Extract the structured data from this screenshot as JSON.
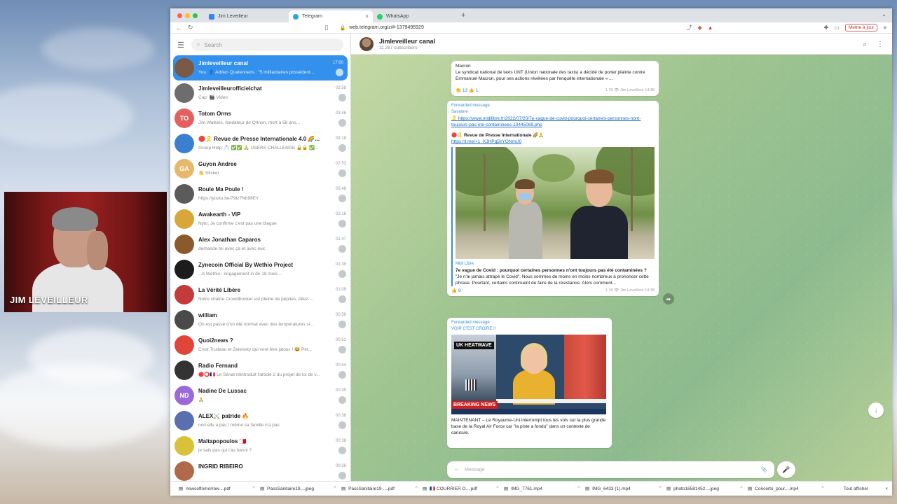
{
  "webcam": {
    "name": "JIM LEVEILLEUR"
  },
  "browser": {
    "tabs": [
      {
        "label": "Jim Leveilleur",
        "color": "#3b82f6"
      },
      {
        "label": "Telegram",
        "color": "#2aa3e0",
        "active": true
      },
      {
        "label": "WhatsApp",
        "color": "#25d366"
      }
    ],
    "new_tab": "+",
    "close": "×",
    "url": "web.telegram.org/z/#-1379495929",
    "update_button": "Mettre à jour"
  },
  "telegram": {
    "search_placeholder": "Search",
    "chats": [
      {
        "name": "Jimleveilleur canal",
        "time": "17:00",
        "preview": "You: 👤 Adrien Quatennens : \"5 milliardaires possèdent...",
        "initials": "",
        "color": "#7a5a44",
        "active": true
      },
      {
        "name": "Jimleveilleurofficielchat",
        "time": "02:58",
        "preview": "Cap: 🎬 Video",
        "initials": "",
        "color": "#6d6d6d"
      },
      {
        "name": "Totom Orms",
        "time": "03:46",
        "preview": "Jim Watkins, fondateur de Q4non, mort à 58 ans...",
        "initials": "TO",
        "color": "#e45f5f"
      },
      {
        "name": "🔴🎗️ Revue de Presse Internationale 4.0 🌈...",
        "time": "03:18",
        "preview": "Group Help: 📩 ✅✅ 🙏 USERS CHALLENGE 🔒🔒 ✅...",
        "initials": "",
        "color": "#3b7fd1"
      },
      {
        "name": "Guyon Andree",
        "time": "02:53",
        "preview": "👋 Sticker",
        "initials": "GA",
        "color": "#e8b86a"
      },
      {
        "name": "Roule Ma Poule !",
        "time": "02:48",
        "preview": "https://youtu.be/79Iz7Nb98EY",
        "initials": "",
        "color": "#5b5b5b"
      },
      {
        "name": "Awakearth - VIP",
        "time": "02:16",
        "preview": "Nyto: Je confirme c'est pas une blague",
        "initials": "",
        "color": "#d9a63a"
      },
      {
        "name": "Alex Jonathan Caparos",
        "time": "01:47",
        "preview": "demande toi avec ça et avec eux",
        "initials": "",
        "color": "#8a5a2a"
      },
      {
        "name": "Zynecoin Official By Wethio Project",
        "time": "01:39",
        "preview": "...b Wethio : engagement in de 18 mois...",
        "initials": "",
        "color": "#1c1c1c"
      },
      {
        "name": "La Vérité Libère",
        "time": "01:09",
        "preview": "Notre chaîne Crowdbunker est pleine de pépites. Allez-...",
        "initials": "",
        "color": "#c43b3b"
      },
      {
        "name": "william",
        "time": "00:59",
        "preview": "On est passé d'un été normal avec des températures si...",
        "initials": "",
        "color": "#4a4a4a"
      },
      {
        "name": "Quoi2news ?",
        "time": "00:52",
        "preview": "C'est Trudeau et Zelensky qui vont être jaloux ! 😂 Pet...",
        "initials": "",
        "color": "#e0453a"
      },
      {
        "name": "Radio Fernand",
        "time": "00:44",
        "preview": "🔴⭕🇫🇷 Le Sénat réintroduit l'article 2 du projet de loi de v...",
        "initials": "",
        "color": "#333333"
      },
      {
        "name": "Nadine De Lussac",
        "time": "00:39",
        "preview": "🙏",
        "initials": "ND",
        "color": "#9b6ad8"
      },
      {
        "name": "ALEX⚔️ patride 🔥",
        "time": "00:38",
        "preview": "non elle a pas ! même sa famille n'a pas",
        "initials": "",
        "color": "#5a6fb0"
      },
      {
        "name": "Maltapopoulos 🇲🇹",
        "time": "00:38",
        "preview": "je sais pas qui t'as banni ?",
        "initials": "",
        "color": "#d8c23a"
      },
      {
        "name": "INGRID RIBEIRO",
        "time": "00:36",
        "preview": "",
        "initials": "",
        "color": "#b06a4a"
      }
    ],
    "channel": {
      "title": "Jimleveilleur canal",
      "subtitle": "11 267 subscribers"
    },
    "messages": {
      "m1": {
        "head": "Macron",
        "text": "Le syndicat national de taxis UNT (Union nationale des taxis) a décidé de porter plainte contre Emmanuel Macron, pour ses actions révélées par l'enquête internationale « ...",
        "reactions": "👏 13   👍 1",
        "stamp": "1.7K 👁 Jim Leveilleur 14:38"
      },
      "m2": {
        "forwarded": "Forwarded message",
        "source": "Savanne",
        "link": "🎗️ https://www.midilibre.fr/2022/07/20/7e-vague-de-covid-pourquoi-certaines-personnes-nont-toujours-pas-ete-contaminees-10445069.php",
        "title": "🔴🎗️ Revue de Presse Internationale 🌈🙏",
        "title_link": "https://t.me/+1_KJHPg5lrYONmU0",
        "site": "Midi Libre",
        "preview_title": "7e vague de Covid : pourquoi certaines personnes n'ont toujours pas été contaminées ?",
        "preview_text": "\"Je n'ai jamais attrapé le Covid\". Nous sommes de moins en moins nombreux à prononcer cette phrase. Pourtant, certains continuent de faire de la résistance. Alors comment...",
        "reactions": "👍 9",
        "stamp": "1.7K 👁 Jim Leveilleur 14:38"
      },
      "m3": {
        "forwarded": "Forwarded message",
        "source": "VOIR C'EST CROIRE !!",
        "tv_tag": "UK HEATWAVE",
        "breaking": "BREAKING NEWS",
        "text": "MAINTENANT – Le Royaume-Uni interrompt tous les vols sur la plus grande base de la Royal Air Force car \"la piste a fondu\" dans un contexte de canicule."
      }
    },
    "composer_placeholder": "Message"
  },
  "downloads": {
    "items": [
      "newsoftomorrow....pdf",
      "PassSanitaire19....jpeg",
      "PassSanitaire19-....pdf",
      "🇫🇷 COURRIER O....pdf",
      "IMG_7761.mp4",
      "IMG_6433 (1).mp4",
      "photo16581452....jpeg",
      "Concerto_pour....mp4"
    ],
    "show_all": "Tout afficher",
    "close": "×"
  }
}
